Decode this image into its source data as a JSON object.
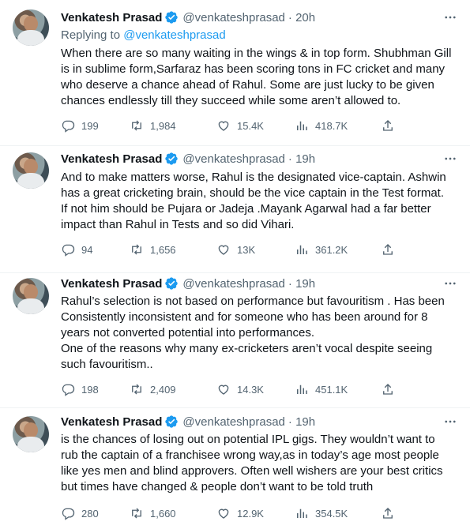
{
  "tweets": [
    {
      "name": "Venkatesh Prasad",
      "handle": "@venkateshprasad",
      "time": "· 20h",
      "replying_prefix": "Replying to ",
      "replying_handle": "@venkateshprasad",
      "lines": [
        "When there are so many waiting in the wings & in top form. Shubhman Gill",
        "is in sublime form,Sarfaraz has been scoring tons in FC cricket and many",
        "who deserve a chance ahead of Rahul. Some are just lucky to be given",
        "chances endlessly till they succeed while some aren’t allowed to."
      ],
      "replies": "199",
      "retweets": "1,984",
      "likes": "15.4K",
      "views": "418.7K"
    },
    {
      "name": "Venkatesh Prasad",
      "handle": "@venkateshprasad",
      "time": "· 19h",
      "lines": [
        "And to make matters worse, Rahul is the designated vice-captain. Ashwin",
        "has a great cricketing brain, should be the vice captain in the Test format.",
        "If not him should be Pujara or Jadeja .Mayank Agarwal had a far better",
        "impact than Rahul in Tests and so did Vihari."
      ],
      "replies": "94",
      "retweets": "1,656",
      "likes": "13K",
      "views": "361.2K"
    },
    {
      "name": "Venkatesh Prasad",
      "handle": "@venkateshprasad",
      "time": "· 19h",
      "lines": [
        "Rahul’s selection is not based on performance but favouritism . Has been",
        "Consistently inconsistent and for someone who has been around for 8",
        "years not converted potential into performances.",
        "One of the reasons why many ex-cricketers aren’t vocal despite seeing",
        "such favouritism.."
      ],
      "replies": "198",
      "retweets": "2,409",
      "likes": "14.3K",
      "views": "451.1K"
    },
    {
      "name": "Venkatesh Prasad",
      "handle": "@venkateshprasad",
      "time": "· 19h",
      "lines": [
        "is the chances of losing out on potential IPL gigs. They wouldn’t want to",
        "rub the captain of a franchisee wrong way,as in today’s age most people",
        "like yes men and blind approvers. Often well wishers are your best critics",
        "but times have changed & people don’t want to be told truth"
      ],
      "replies": "280",
      "retweets": "1,660",
      "likes": "12.9K",
      "views": "354.5K"
    }
  ],
  "colors": {
    "accent": "#1d9bf0",
    "secondary_text": "#536471",
    "divider": "#eff3f4"
  }
}
